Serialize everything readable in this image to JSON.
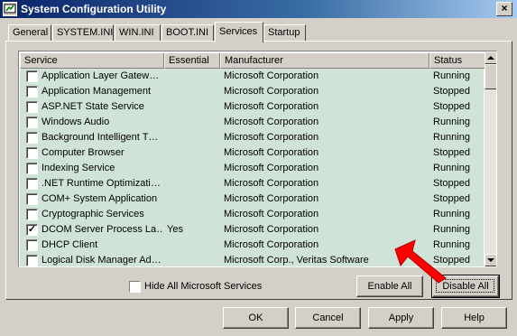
{
  "window": {
    "title": "System Configuration Utility",
    "close_glyph": "×"
  },
  "tabs": [
    {
      "label": "General"
    },
    {
      "label": "SYSTEM.INI"
    },
    {
      "label": "WIN.INI"
    },
    {
      "label": "BOOT.INI"
    },
    {
      "label": "Services",
      "active": true
    },
    {
      "label": "Startup"
    }
  ],
  "services_list": {
    "columns": [
      "Service",
      "Essential",
      "Manufacturer",
      "Status"
    ],
    "rows": [
      {
        "checked": false,
        "service": "Application Layer Gatew…",
        "essential": "",
        "manufacturer": "Microsoft Corporation",
        "status": "Running"
      },
      {
        "checked": false,
        "service": "Application Management",
        "essential": "",
        "manufacturer": "Microsoft Corporation",
        "status": "Stopped"
      },
      {
        "checked": false,
        "service": "ASP.NET State Service",
        "essential": "",
        "manufacturer": "Microsoft Corporation",
        "status": "Stopped"
      },
      {
        "checked": false,
        "service": "Windows Audio",
        "essential": "",
        "manufacturer": "Microsoft Corporation",
        "status": "Running"
      },
      {
        "checked": false,
        "service": "Background Intelligent T…",
        "essential": "",
        "manufacturer": "Microsoft Corporation",
        "status": "Running"
      },
      {
        "checked": false,
        "service": "Computer Browser",
        "essential": "",
        "manufacturer": "Microsoft Corporation",
        "status": "Stopped"
      },
      {
        "checked": false,
        "service": "Indexing Service",
        "essential": "",
        "manufacturer": "Microsoft Corporation",
        "status": "Running"
      },
      {
        "checked": false,
        "service": ".NET Runtime Optimizati…",
        "essential": "",
        "manufacturer": "Microsoft Corporation",
        "status": "Stopped"
      },
      {
        "checked": false,
        "service": "COM+ System Application",
        "essential": "",
        "manufacturer": "Microsoft Corporation",
        "status": "Stopped"
      },
      {
        "checked": false,
        "service": "Cryptographic Services",
        "essential": "",
        "manufacturer": "Microsoft Corporation",
        "status": "Running"
      },
      {
        "checked": true,
        "service": "DCOM Server Process La…",
        "essential": "Yes",
        "manufacturer": "Microsoft Corporation",
        "status": "Running"
      },
      {
        "checked": false,
        "service": "DHCP Client",
        "essential": "",
        "manufacturer": "Microsoft Corporation",
        "status": "Running"
      },
      {
        "checked": false,
        "service": "Logical Disk Manager Ad…",
        "essential": "",
        "manufacturer": "Microsoft Corp., Veritas Software",
        "status": "Stopped"
      }
    ]
  },
  "options": {
    "hide_ms_services_label": "Hide All Microsoft Services",
    "hide_ms_services_checked": false
  },
  "panel_buttons": {
    "enable_all": "Enable All",
    "disable_all": "Disable All"
  },
  "dialog_buttons": {
    "ok": "OK",
    "cancel": "Cancel",
    "apply": "Apply",
    "help": "Help"
  },
  "colors": {
    "title_gradient_start": "#0a246a",
    "title_gradient_end": "#a6caf0",
    "list_background": "#cfe4d6",
    "annotation_arrow": "#ff0000"
  },
  "icons": {
    "title": "msconfig-icon",
    "annotation": "red-arrow-icon"
  }
}
